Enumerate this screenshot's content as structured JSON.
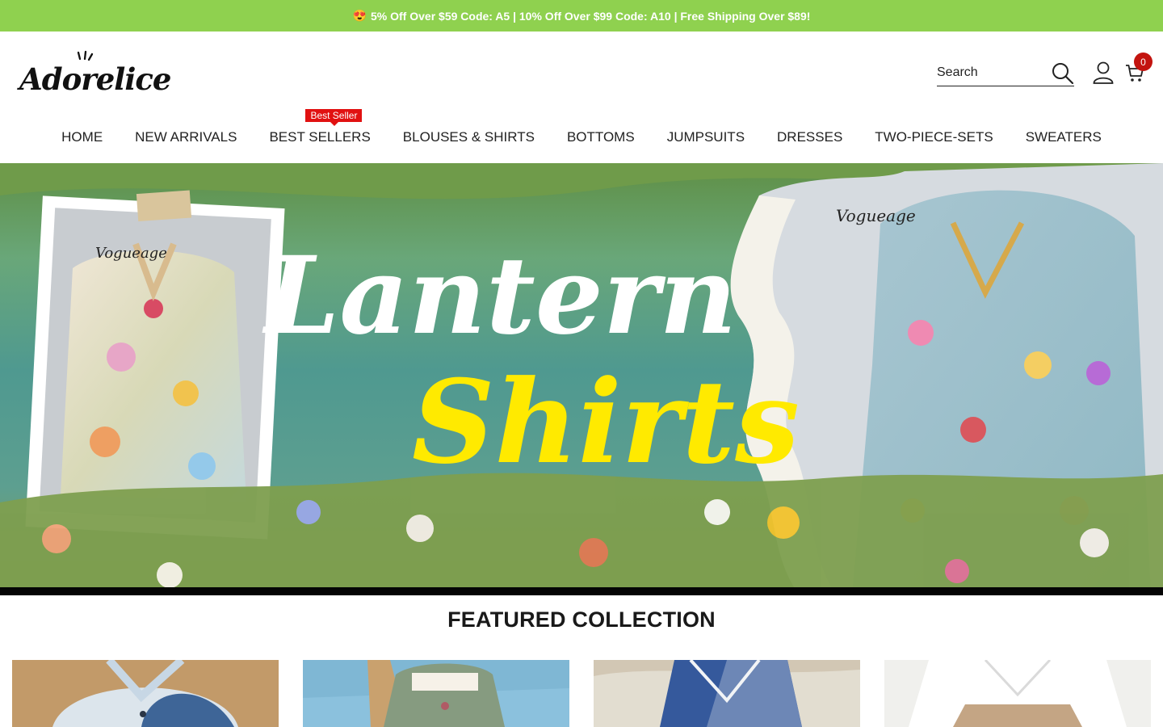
{
  "announcement": {
    "emoji": "😍",
    "text": "5% Off Over $59 Code: A5  |  10% Off Over $99 Code: A10  |  Free Shipping Over $89!"
  },
  "brand": {
    "name": "Adorelice"
  },
  "search": {
    "placeholder": "Search"
  },
  "cart": {
    "count": "0"
  },
  "nav": {
    "items": [
      {
        "label": "HOME"
      },
      {
        "label": "NEW ARRIVALS"
      },
      {
        "label": "BEST SELLERS",
        "badge": "Best Seller"
      },
      {
        "label": "BLOUSES & SHIRTS"
      },
      {
        "label": "BOTTOMS"
      },
      {
        "label": "JUMPSUITS"
      },
      {
        "label": "DRESSES"
      },
      {
        "label": "TWO-PIECE-SETS"
      },
      {
        "label": "SWEATERS"
      }
    ]
  },
  "hero": {
    "line1": "Lantern",
    "line2": "Shirts",
    "brand_mark": "Vogueage",
    "line1_color": "#ffffff",
    "line2_color": "#ffea00"
  },
  "featured": {
    "title": "FEATURED COLLECTION"
  },
  "colors": {
    "announcement_bg": "#8fd14f",
    "badge_red": "#e11111",
    "cart_red": "#c3140f"
  }
}
